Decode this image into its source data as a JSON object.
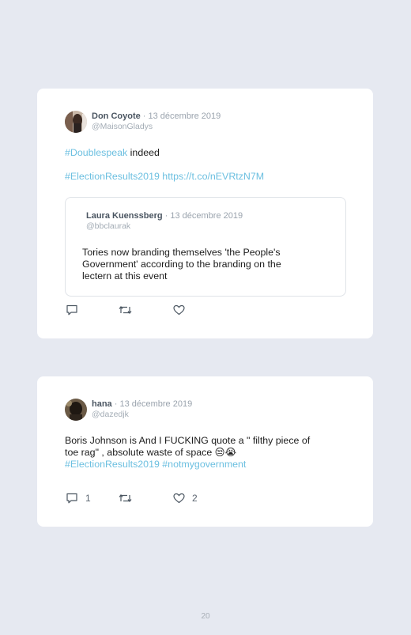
{
  "tweets": [
    {
      "author": "Don Coyote",
      "date": " · 13 décembre 2019",
      "handle": "@MaisonGladys",
      "hashtag1": "#Doublespeak",
      "text1": " indeed",
      "hashtag2": "#ElectionResults2019",
      "link": " https://t.co/nEVRtzN7M",
      "quoted": {
        "author": "Laura Kuenssberg",
        "date": " · 13 décembre 2019",
        "handle": "@bbclaurak",
        "lines": [
          "Tories now branding themselves 'the People's",
          "Government' according to the branding on the",
          "lectern at this event"
        ]
      }
    },
    {
      "author": "hana",
      "date": " · 13 décembre 2019",
      "handle": "@dazedjk",
      "line1": "Boris Johnson is And I FUCKING quote a \" filthy piece of",
      "line2": "toe rag\" , absolute waste of space 😒😭",
      "hashtags": "#ElectionResults2019 #notmygovernment",
      "reply_count": "1",
      "like_count": "2"
    }
  ],
  "page_number": "20",
  "colors": {
    "link": "#6bbfe0",
    "background": "#e6e9f1",
    "card": "#ffffff"
  }
}
